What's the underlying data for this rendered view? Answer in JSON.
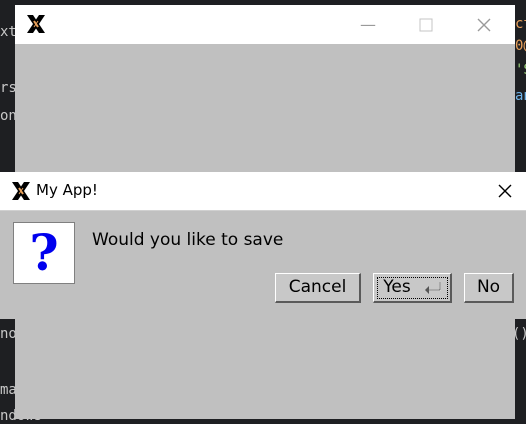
{
  "background": {
    "left_fragments": [
      "xt.",
      "rs",
      "on",
      "no",
      "ma"
    ],
    "right_fragments": [
      "ct",
      "0@",
      "'S",
      "an",
      "()"
    ],
    "bottom_fragment": "ndows"
  },
  "main_window": {
    "controls": [
      "minimize",
      "maximize",
      "close"
    ]
  },
  "dialog": {
    "title": "My App!",
    "message": "Would you like to save",
    "buttons": {
      "cancel": "Cancel",
      "yes": "Yes",
      "no": "No"
    },
    "icon": "question-icon"
  },
  "colors": {
    "window_bg": "#c0c0c0",
    "question_mark": "#0000ee",
    "editor_bg": "#1e1f22"
  }
}
